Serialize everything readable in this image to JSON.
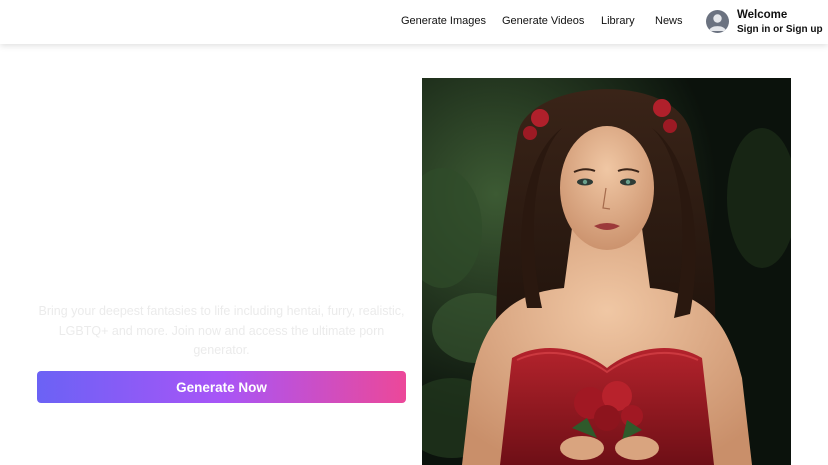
{
  "nav": {
    "items": [
      {
        "label": "Generate Images"
      },
      {
        "label": "Generate Videos"
      },
      {
        "label": "Library"
      },
      {
        "label": "News"
      }
    ]
  },
  "user": {
    "welcome": "Welcome",
    "signin": "Sign in or Sign up",
    "avatar_icon": "user-avatar-icon"
  },
  "hero": {
    "tagline": "Bring your deepest fantasies to life including hentai, furry, realistic, LGBTQ+ and more. Join now and access the ultimate porn generator.",
    "cta_label": "Generate Now",
    "image_icon": "generated-portrait-image"
  },
  "colors": {
    "cta_gradient_start": "#6b62f5",
    "cta_gradient_mid": "#a855f7",
    "cta_gradient_end": "#ec4899",
    "tagline_text": "#ebebeb"
  }
}
